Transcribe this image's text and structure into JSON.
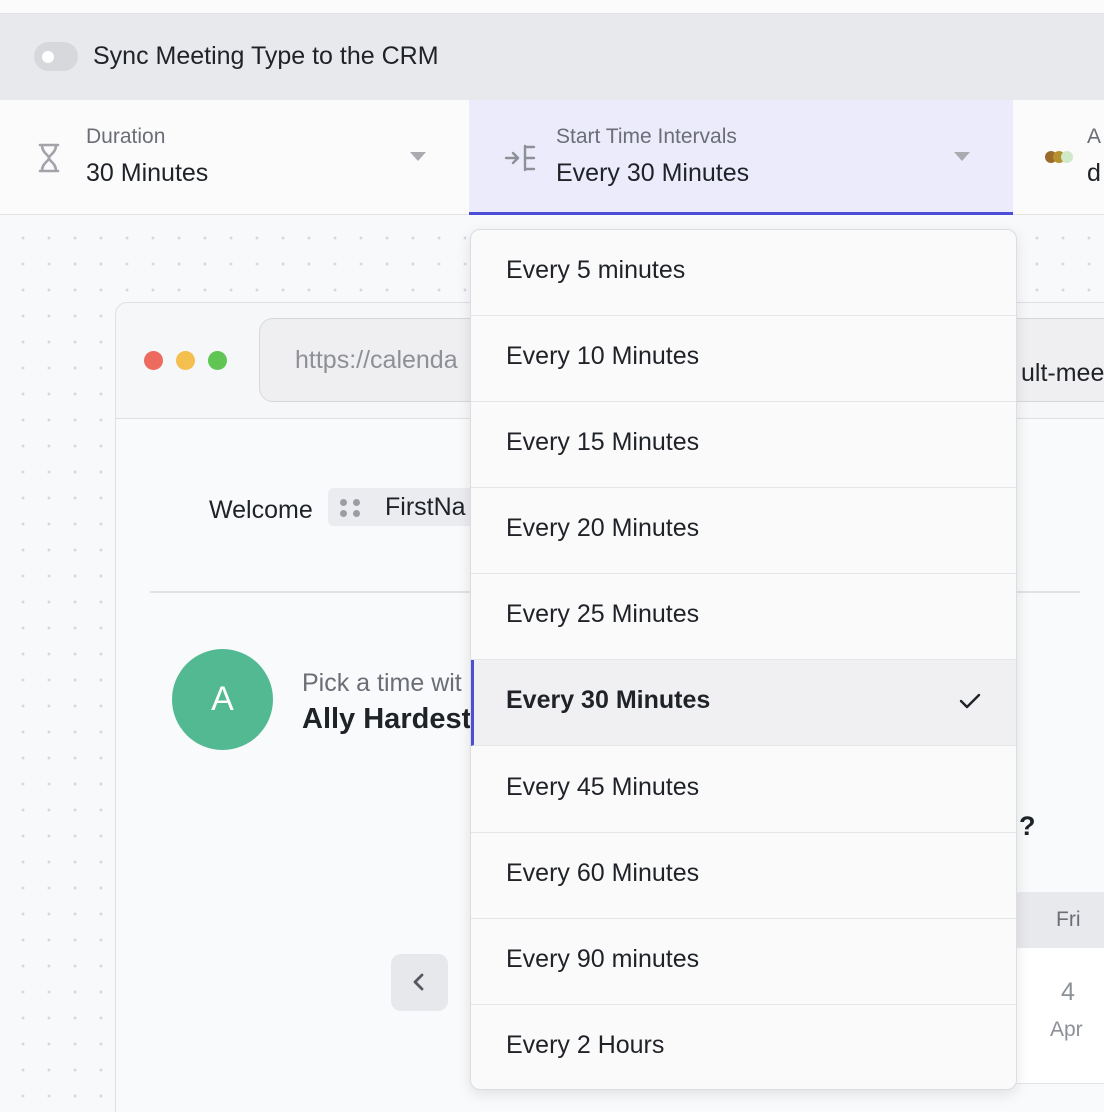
{
  "sync": {
    "label": "Sync Meeting Type to the CRM",
    "enabled": false
  },
  "settings": {
    "duration": {
      "label": "Duration",
      "value": "30 Minutes"
    },
    "interval": {
      "label": "Start Time Intervals",
      "value": "Every 30 Minutes"
    },
    "third": {
      "label_partial": "A",
      "value_partial": "d"
    }
  },
  "preview": {
    "url_partial": "https://calenda",
    "url_right_partial": "ult-meet",
    "welcome_text": "Welcome",
    "token_partial": "FirstNa",
    "avatar_initial": "A",
    "pick_text_partial": "Pick a time wit",
    "host_name_partial": "Ally Hardest",
    "question_partial": "?",
    "calendar": {
      "weekday": "Fri",
      "day": "4",
      "month": "Apr"
    }
  },
  "dropdown": {
    "selected_index": 5,
    "options": [
      "Every 5 minutes",
      "Every 10 Minutes",
      "Every 15 Minutes",
      "Every 20 Minutes",
      "Every 25 Minutes",
      "Every 30 Minutes",
      "Every 45 Minutes",
      "Every 60 Minutes",
      "Every 90 minutes",
      "Every 2 Hours"
    ]
  },
  "colors": {
    "accent": "#4b4fd6",
    "avatar": "#52b992",
    "traffic_red": "#ec6a5e",
    "traffic_yellow": "#f4bf4f",
    "traffic_green": "#61c554"
  }
}
